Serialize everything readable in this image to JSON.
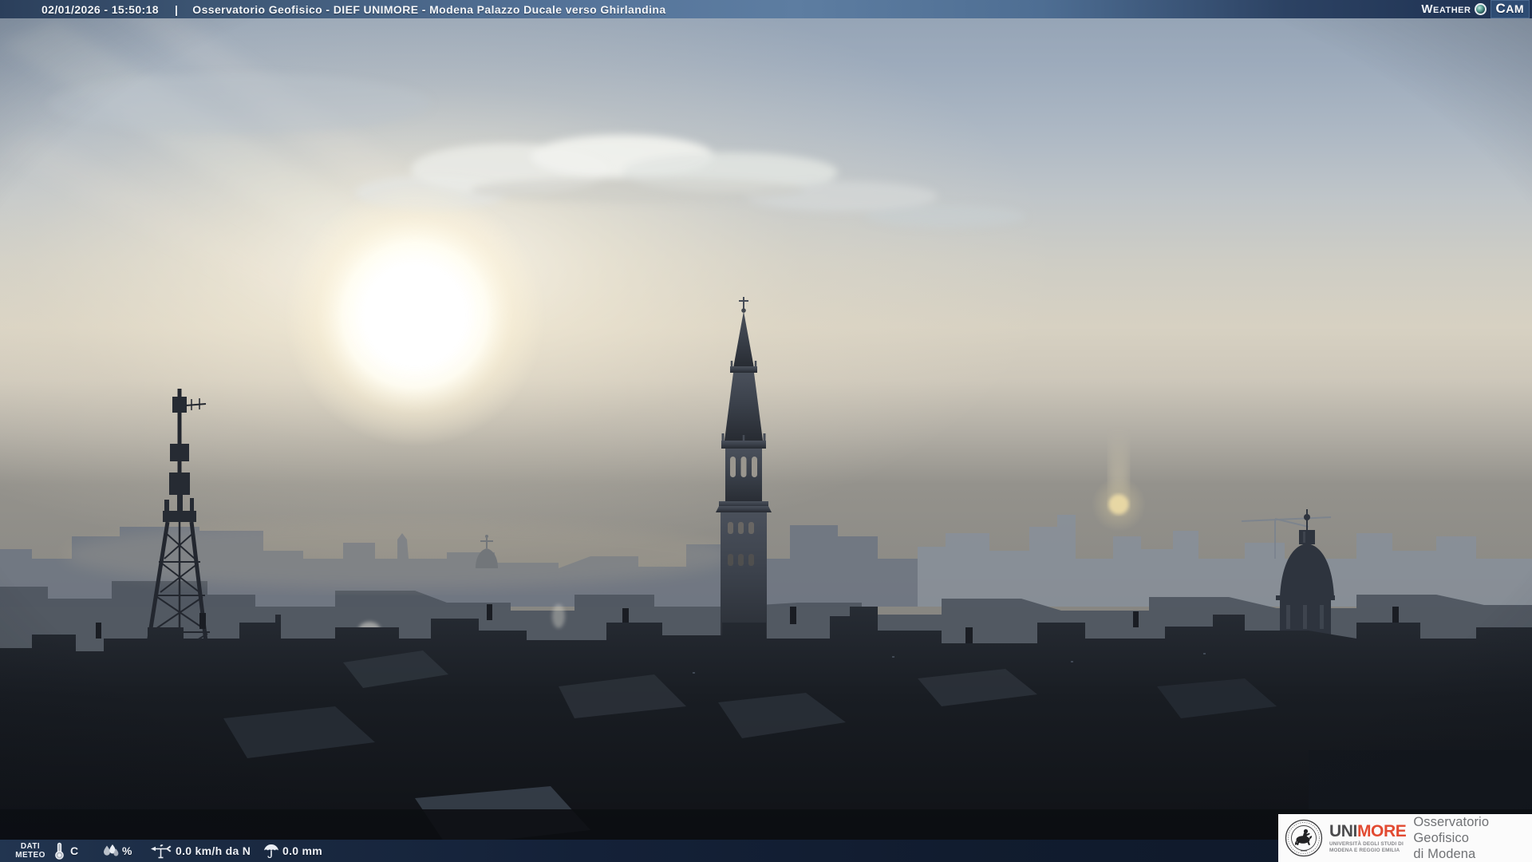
{
  "top_bar": {
    "timestamp": "02/01/2026 - 15:50:18",
    "separator": "|",
    "title": "Osservatorio Geofisico - DIEF UNIMORE - Modena Palazzo Ducale verso Ghirlandina"
  },
  "watermark": {
    "weather": "WEATHER",
    "cam": "CAM"
  },
  "weather_bar": {
    "label": [
      "DATI",
      "METEO"
    ],
    "temperature_unit": "C",
    "humidity_unit": "%",
    "wind_value": "0.0 km/h da N",
    "rain_value": "0.0 mm"
  },
  "logo": {
    "uni": "UNI",
    "more": "MORE",
    "subtitle_line1": "UNIVERSITÀ DEGLI STUDI DI",
    "subtitle_line2": "MODENA E REGGIO EMILIA",
    "right_line1": "Osservatorio Geofisico",
    "right_line2": "di Modena"
  },
  "colors": {
    "top_bar_navy": "#2c4263",
    "bottom_bar_navy": "#142138",
    "brand_cam_blue": "#2e4c73",
    "unimore_red": "#e24a31",
    "unimore_gray": "#4c4c4e"
  },
  "scene": {
    "subject": "Modena skyline toward Ghirlandina tower in hazy sunset light",
    "landmarks": [
      "sun",
      "cloud bank",
      "Ghirlandina tower",
      "telecom lattice tower",
      "church dome",
      "lens flare sun",
      "city rooftops"
    ]
  }
}
